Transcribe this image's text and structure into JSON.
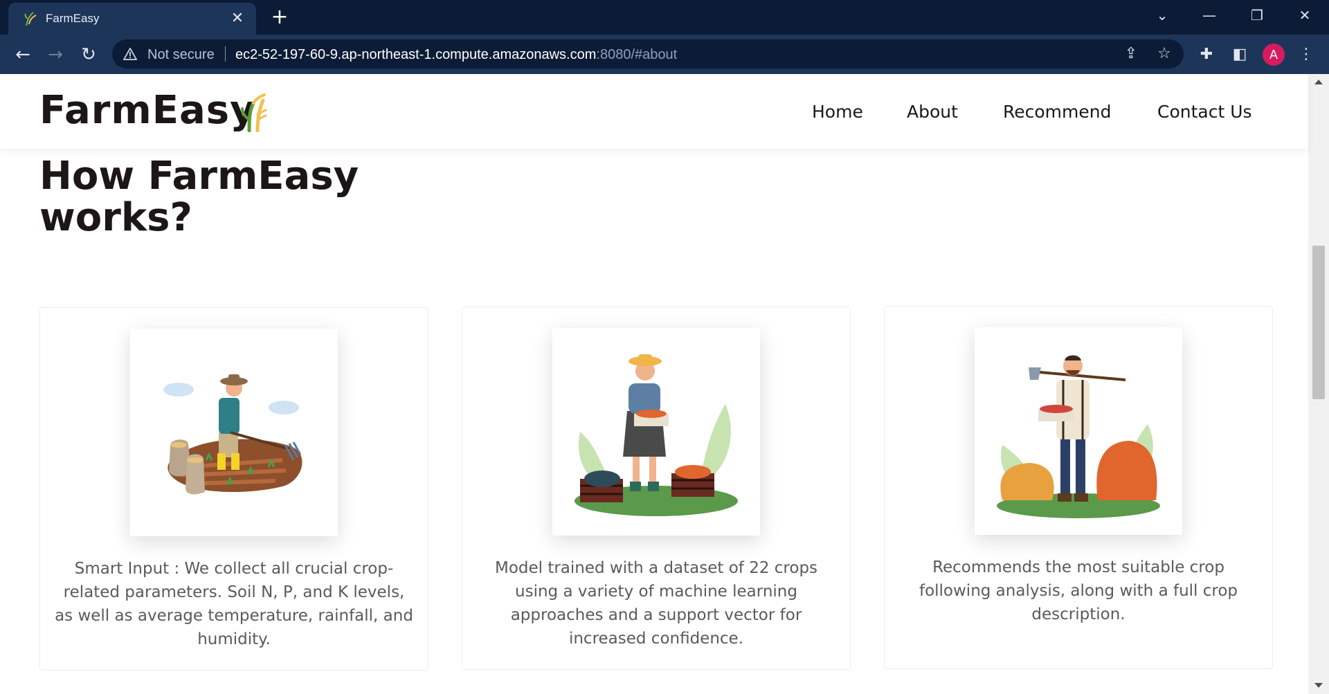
{
  "browser": {
    "tab_title": "FarmEasy",
    "tab_close": "✕",
    "new_tab": "+",
    "security_label": "Not secure",
    "url_host": "ec2-52-197-60-9.ap-northeast-1.compute.amazonaws.com",
    "url_rest": ":8080/#about",
    "profile_initial": "A"
  },
  "site": {
    "brand": "FarmEasy",
    "nav": [
      "Home",
      "About",
      "Recommend",
      "Contact Us"
    ]
  },
  "section": {
    "title": "How FarmEasy works?",
    "cards": [
      {
        "text": "Smart Input : We collect all crucial crop-related parameters. Soil N, P, and K levels, as well as average temperature, rainfall, and humidity."
      },
      {
        "text": "Model trained with a dataset of 22 crops using a variety of machine learning approaches and a support vector for increased confidence."
      },
      {
        "text": "Recommends the most suitable crop following analysis, along with a full crop description."
      }
    ]
  },
  "colors": {
    "chrome_dark": "#0c1c36",
    "chrome_tab": "#1d3559",
    "heading": "#1c1616",
    "body_text": "#5a5a5a",
    "profile": "#d81b60"
  }
}
